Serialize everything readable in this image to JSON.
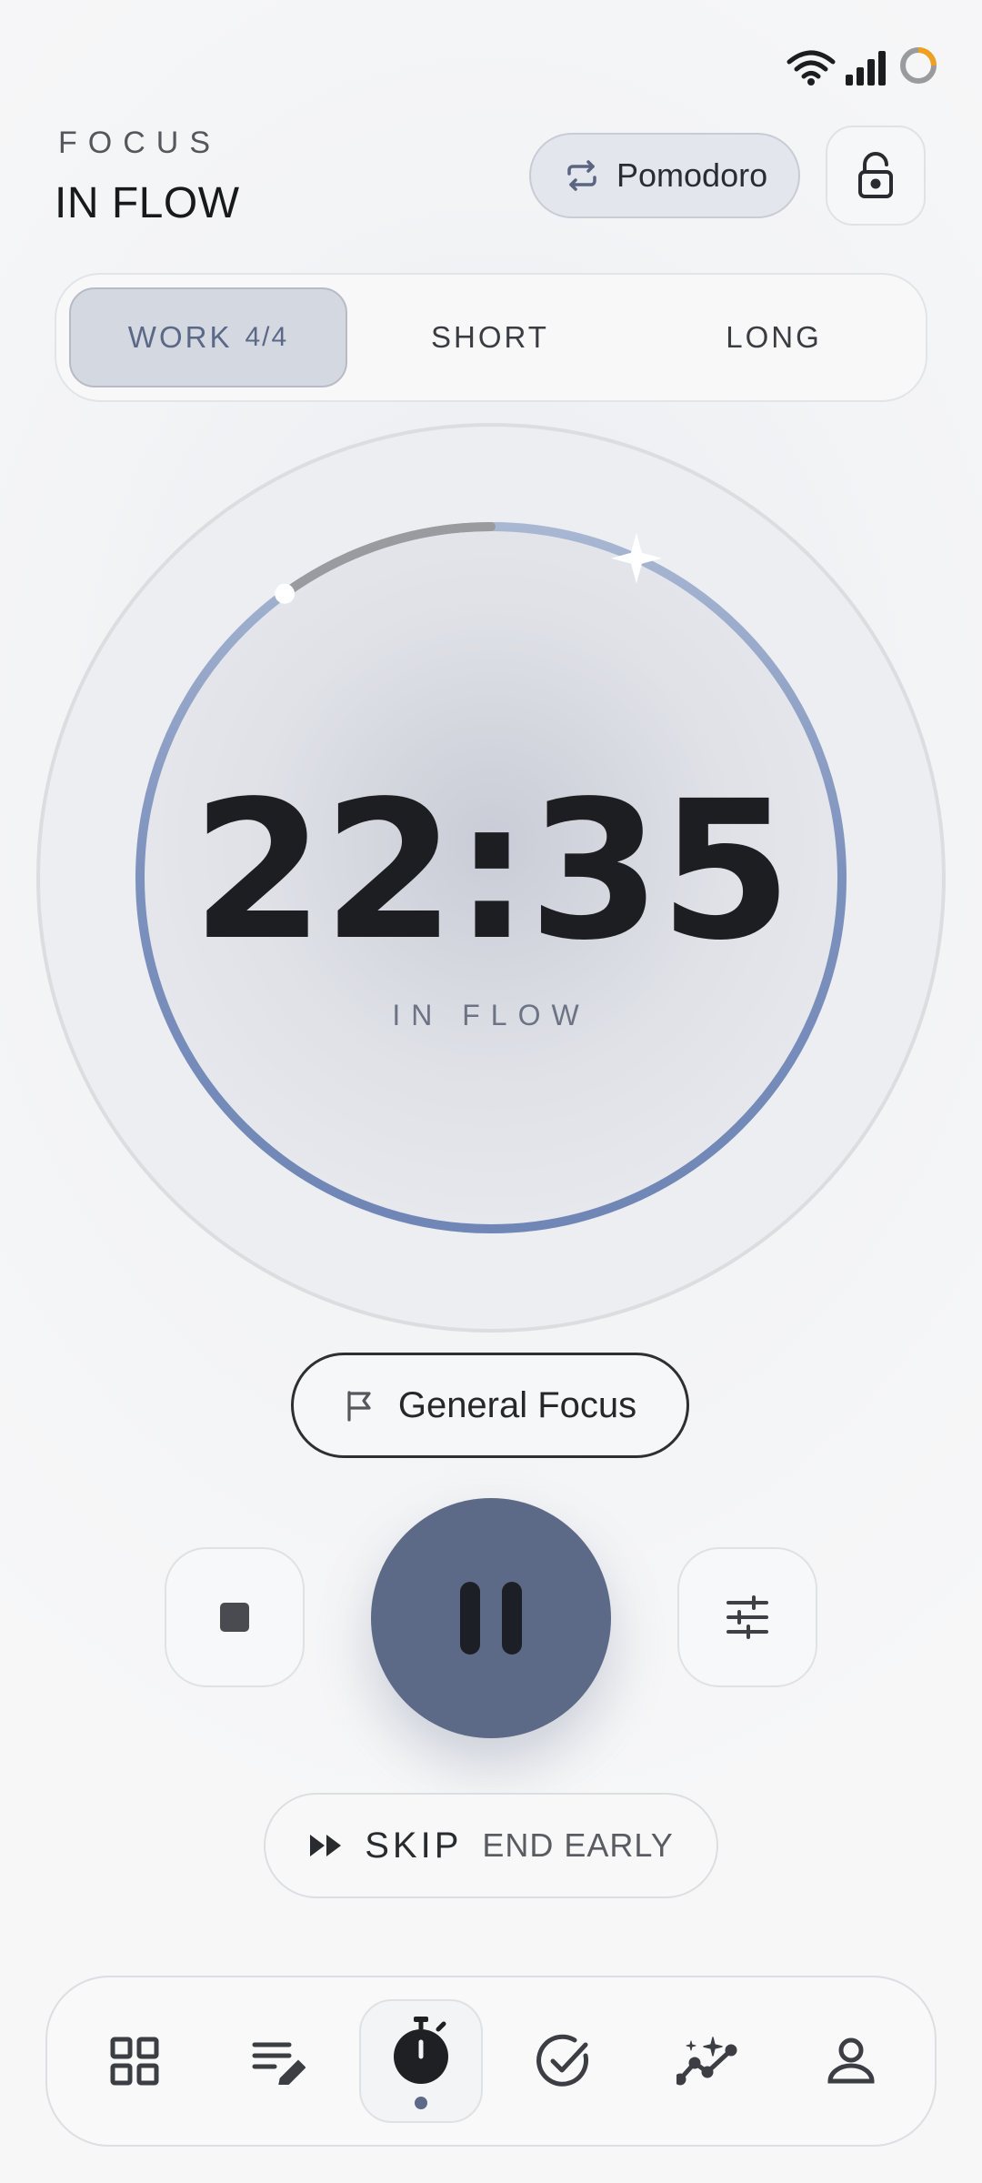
{
  "status_bar": {
    "wifi_icon": "wifi-icon",
    "signal_icon": "signal-icon",
    "battery_icon": "battery-ring-icon",
    "battery_accent": "#f0a020"
  },
  "header": {
    "eyebrow": "FOCUS",
    "title": "IN FLOW"
  },
  "mode_button": {
    "icon": "repeat-icon",
    "label": "Pomodoro"
  },
  "lock_button": {
    "icon": "lock-icon"
  },
  "segments": [
    {
      "label": "WORK",
      "count": "4/4",
      "active": true
    },
    {
      "label": "SHORT",
      "count": "",
      "active": false
    },
    {
      "label": "LONG",
      "count": "",
      "active": false
    }
  ],
  "timer": {
    "time": "22:35",
    "state_label": "IN FLOW",
    "progress_fraction": 0.1,
    "colors": {
      "ring": "#6f86b6",
      "ring_light": "#a8b7d2",
      "elapsed": "#9a9b9e"
    }
  },
  "task": {
    "icon": "flag-icon",
    "label": "General Focus"
  },
  "controls": {
    "stop_icon": "stop-icon",
    "pause_icon": "pause-icon",
    "settings_icon": "sliders-icon",
    "accent": "#5c6a87"
  },
  "skip": {
    "icon": "fast-forward-icon",
    "label": "SKIP",
    "sublabel": "END EARLY"
  },
  "nav": {
    "items": [
      {
        "icon": "grid-icon",
        "active": false
      },
      {
        "icon": "notes-edit-icon",
        "active": false
      },
      {
        "icon": "stopwatch-icon",
        "active": true
      },
      {
        "icon": "check-circle-icon",
        "active": false
      },
      {
        "icon": "sparkle-chart-icon",
        "active": false
      },
      {
        "icon": "profile-icon",
        "active": false
      }
    ]
  }
}
